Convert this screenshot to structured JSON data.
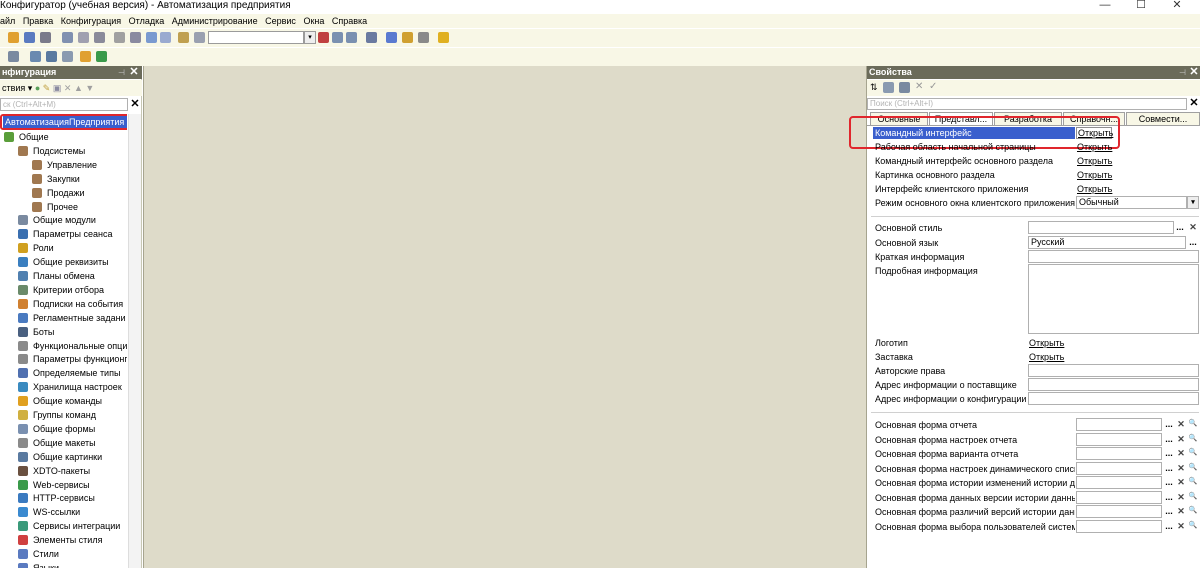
{
  "window": {
    "title": "Конфигуратор (учебная версия) - Автоматизация предприятия",
    "controls": [
      "—",
      "☐",
      "✕"
    ]
  },
  "menu": [
    "айл",
    "Правка",
    "Конфигурация",
    "Отладка",
    "Администрирование",
    "Сервис",
    "Окна",
    "Справка"
  ],
  "left_panel": {
    "title": "нфигурация",
    "actions_label": "ствия ▾",
    "search_placeholder": "ск (Ctrl+Alt+M)",
    "root_node": "АвтоматизацияПредприятия",
    "tree": [
      {
        "label": "Общие",
        "icon": "folder-icon",
        "color": "#5a9e3a",
        "level": 0
      },
      {
        "label": "Подсистемы",
        "icon": "subsystems-icon",
        "color": "#a07850",
        "level": 1
      },
      {
        "label": "Управление",
        "icon": "subsystem-icon",
        "color": "#a07850",
        "level": 2
      },
      {
        "label": "Закупки",
        "icon": "subsystem-icon",
        "color": "#a07850",
        "level": 2
      },
      {
        "label": "Продажи",
        "icon": "subsystem-icon",
        "color": "#a07850",
        "level": 2
      },
      {
        "label": "Прочее",
        "icon": "subsystem-icon",
        "color": "#a07850",
        "level": 2
      },
      {
        "label": "Общие модули",
        "icon": "module-icon",
        "color": "#7a8aa0",
        "level": 1
      },
      {
        "label": "Параметры сеанса",
        "icon": "session-params-icon",
        "color": "#3a6fb0",
        "level": 1
      },
      {
        "label": "Роли",
        "icon": "roles-icon",
        "color": "#d0a020",
        "level": 1
      },
      {
        "label": "Общие реквизиты",
        "icon": "attributes-icon",
        "color": "#3a7fc0",
        "level": 1
      },
      {
        "label": "Планы обмена",
        "icon": "exchange-plans-icon",
        "color": "#5080b0",
        "level": 1
      },
      {
        "label": "Критерии отбора",
        "icon": "filter-criteria-icon",
        "color": "#6a8a6a",
        "level": 1
      },
      {
        "label": "Подписки на события",
        "icon": "event-subscriptions-icon",
        "color": "#d08030",
        "level": 1
      },
      {
        "label": "Регламентные задани",
        "icon": "scheduled-jobs-icon",
        "color": "#4a7ac0",
        "level": 1
      },
      {
        "label": "Боты",
        "icon": "bots-icon",
        "color": "#4a6080",
        "level": 1
      },
      {
        "label": "Функциональные опци",
        "icon": "functional-options-icon",
        "color": "#8a8a8a",
        "level": 1
      },
      {
        "label": "Параметры функционг",
        "icon": "functional-params-icon",
        "color": "#8a8a8a",
        "level": 1
      },
      {
        "label": "Определяемые типы",
        "icon": "defined-types-icon",
        "color": "#5070b0",
        "level": 1
      },
      {
        "label": "Хранилища настроек",
        "icon": "settings-storage-icon",
        "color": "#3a8ac0",
        "level": 1
      },
      {
        "label": "Общие команды",
        "icon": "common-commands-icon",
        "color": "#e0a020",
        "level": 1
      },
      {
        "label": "Группы команд",
        "icon": "command-groups-icon",
        "color": "#d0b040",
        "level": 1
      },
      {
        "label": "Общие формы",
        "icon": "common-forms-icon",
        "color": "#7a90b0",
        "level": 1
      },
      {
        "label": "Общие макеты",
        "icon": "common-templates-icon",
        "color": "#8a8a8a",
        "level": 1
      },
      {
        "label": "Общие картинки",
        "icon": "common-pictures-icon",
        "color": "#5a7aa0",
        "level": 1
      },
      {
        "label": "XDTO-пакеты",
        "icon": "xdto-packages-icon",
        "color": "#6a5040",
        "level": 1
      },
      {
        "label": "Web-сервисы",
        "icon": "web-services-icon",
        "color": "#3a9a4a",
        "level": 1
      },
      {
        "label": "HTTP-сервисы",
        "icon": "http-services-icon",
        "color": "#3a7ac0",
        "level": 1
      },
      {
        "label": "WS-ссылки",
        "icon": "ws-links-icon",
        "color": "#3a8ad0",
        "level": 1
      },
      {
        "label": "Сервисы интеграции",
        "icon": "integration-services-icon",
        "color": "#3a9a7a",
        "level": 1
      },
      {
        "label": "Элементы стиля",
        "icon": "style-items-icon",
        "color": "#d04040",
        "level": 1
      },
      {
        "label": "Стили",
        "icon": "styles-icon",
        "color": "#5a7ac0",
        "level": 1
      },
      {
        "label": "Языки",
        "icon": "languages-icon",
        "color": "#5a7ac0",
        "level": 1
      }
    ]
  },
  "right_panel": {
    "title": "Свойства",
    "search_placeholder": "Поиск (Ctrl+Alt+I)",
    "tabs": [
      "Основные",
      "Представл...",
      "Разработка",
      "Справочн...",
      "Совмести..."
    ],
    "rows": [
      {
        "label": "Командный интерфейс",
        "link": "Открыть",
        "selected": true
      },
      {
        "label": "Рабочая область начальной страницы",
        "link": "Открыть"
      },
      {
        "label": "Командный интерфейс основного раздела",
        "link": "Открыть"
      },
      {
        "label": "Картинка основного раздела",
        "link": "Открыть"
      },
      {
        "label": "Интерфейс клиентского приложения",
        "link": "Открыть"
      }
    ],
    "main_window_mode": {
      "label": "Режим основного окна клиентского приложения",
      "value": "Обычный"
    },
    "style": {
      "label": "Основной стиль",
      "value": ""
    },
    "language": {
      "label": "Основной язык",
      "value": "Русский"
    },
    "brief_info": {
      "label": "Краткая информация",
      "value": ""
    },
    "detailed_info": {
      "label": "Подробная информация",
      "value": ""
    },
    "logo": {
      "label": "Логотип",
      "link": "Открыть"
    },
    "splash": {
      "label": "Заставка",
      "link": "Открыть"
    },
    "copyright": {
      "label": "Авторские права",
      "value": ""
    },
    "vendor_info": {
      "label": "Адрес информации о поставщике",
      "value": ""
    },
    "config_info": {
      "label": "Адрес информации о конфигурации",
      "value": ""
    },
    "forms": [
      "Основная форма отчета",
      "Основная форма настроек отчета",
      "Основная форма варианта отчета",
      "Основная форма настроек динамического списка",
      "Основная форма истории изменений истории данных",
      "Основная форма данных версии истории данных",
      "Основная форма различий версий истории данных",
      "Основная форма выбора пользователей системы"
    ],
    "ellipsis": "...",
    "clear": "✕",
    "search": "🔍"
  }
}
